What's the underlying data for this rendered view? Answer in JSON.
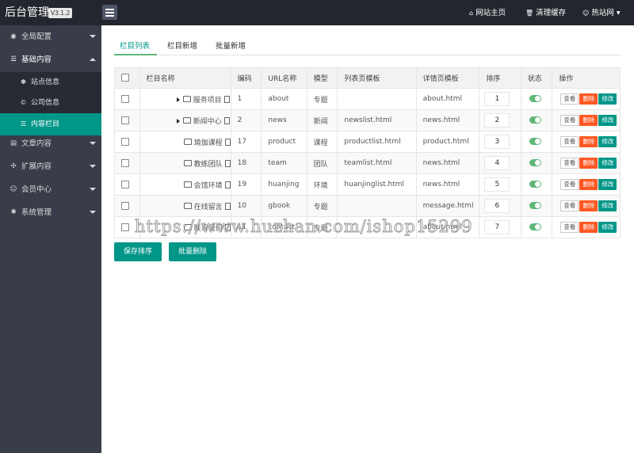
{
  "header": {
    "brand": "后台管理",
    "version": "V3.1.2",
    "links": [
      {
        "icon": "home-icon",
        "glyph": "⌂",
        "label": "网站主页"
      },
      {
        "icon": "trash-icon",
        "glyph": "🗑",
        "label": "清理缓存"
      },
      {
        "icon": "user-icon",
        "glyph": "☺",
        "label": "热站网 ▾"
      }
    ]
  },
  "sidebar": {
    "items": [
      {
        "glyph": "◉",
        "label": "全局配置"
      },
      {
        "glyph": "☰",
        "label": "基础内容"
      },
      {
        "glyph": "▤",
        "label": "文章内容"
      },
      {
        "glyph": "✣",
        "label": "扩展内容"
      },
      {
        "glyph": "☺",
        "label": "会员中心"
      },
      {
        "glyph": "✱",
        "label": "系统管理"
      }
    ],
    "sub_items": [
      {
        "glyph": "✽",
        "label": "站点信息"
      },
      {
        "glyph": "©",
        "label": "公司信息"
      },
      {
        "glyph": "☰",
        "label": "内容栏目"
      }
    ]
  },
  "tabs": [
    "栏目列表",
    "栏目新增",
    "批量新增"
  ],
  "table": {
    "headers": [
      "栏目名称",
      "编码",
      "URL名称",
      "模型",
      "列表页模板",
      "详情页模板",
      "排序",
      "状态",
      "操作"
    ],
    "rows": [
      {
        "name": "服务项目",
        "code": "1",
        "url": "about",
        "model": "专题",
        "list_tpl": "",
        "detail_tpl": "about.html",
        "sort": "1",
        "expandable": true
      },
      {
        "name": "新闻中心",
        "code": "2",
        "url": "news",
        "model": "新闻",
        "list_tpl": "newslist.html",
        "detail_tpl": "news.html",
        "sort": "2",
        "expandable": true
      },
      {
        "name": "瑜伽课程",
        "code": "17",
        "url": "product",
        "model": "课程",
        "list_tpl": "productlist.html",
        "detail_tpl": "product.html",
        "sort": "3",
        "expandable": false
      },
      {
        "name": "教练团队",
        "code": "18",
        "url": "team",
        "model": "团队",
        "list_tpl": "teamlist.html",
        "detail_tpl": "news.html",
        "sort": "4",
        "expandable": false
      },
      {
        "name": "会馆环境",
        "code": "19",
        "url": "huanjing",
        "model": "环境",
        "list_tpl": "huanjinglist.html",
        "detail_tpl": "news.html",
        "sort": "5",
        "expandable": false
      },
      {
        "name": "在线留言",
        "code": "10",
        "url": "gbook",
        "model": "专题",
        "list_tpl": "",
        "detail_tpl": "message.html",
        "sort": "6",
        "expandable": false
      },
      {
        "name": "联系我们",
        "code": "11",
        "url": "contact",
        "model": "专题",
        "list_tpl": "",
        "detail_tpl": "about.html",
        "sort": "7",
        "expandable": false
      }
    ],
    "actions": {
      "view": "查看",
      "delete": "删除",
      "edit": "修改"
    }
  },
  "buttons": {
    "save_sort": "保存排序",
    "batch_delete": "批量删除"
  },
  "watermark": "https://www.huzhan.com/ishop15299",
  "colors": {
    "accent": "#009688",
    "danger": "#ff5722",
    "switch_on": "#5fb878",
    "sidebar_bg": "#393d49",
    "topbar_bg": "#23262e"
  }
}
